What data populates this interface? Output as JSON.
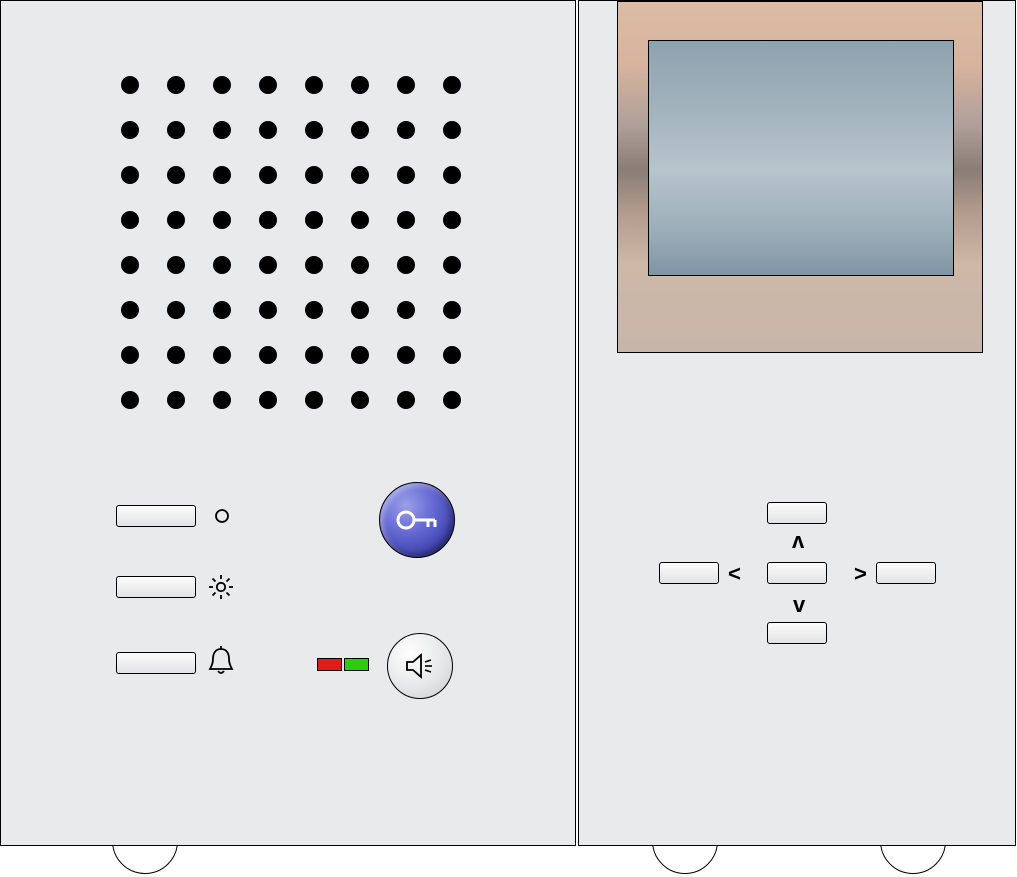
{
  "device": {
    "type": "intercom-station-diagram",
    "left_panel": {
      "speaker_grille": {
        "rows": 8,
        "cols": 8
      },
      "buttons": {
        "aux1": {
          "icon": "circle-icon"
        },
        "light": {
          "icon": "brightness-icon"
        },
        "bell": {
          "icon": "bell-icon"
        }
      },
      "door_open_button": {
        "icon": "key-icon"
      },
      "talk_button": {
        "icon": "speaker-icon"
      },
      "leds": {
        "red": "#e21b1b",
        "green": "#2ecc0f"
      }
    },
    "right_panel": {
      "display": true,
      "dpad": {
        "up": "ʌ",
        "down": "v",
        "left": "<",
        "right": ">",
        "center": ""
      }
    }
  }
}
